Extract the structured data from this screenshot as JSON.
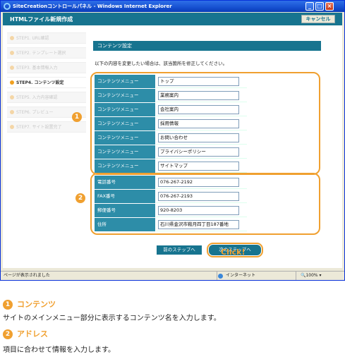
{
  "window": {
    "title": "SiteCreationコントロールパネル - Windows Internet Explorer",
    "minimize_glyph": "_",
    "maximize_glyph": "□",
    "close_glyph": "×"
  },
  "header": {
    "title": "HTMLファイル新規作成",
    "cancel_label": "キャンセル"
  },
  "sidebar": {
    "steps": [
      {
        "label": "STEP1. URL確認"
      },
      {
        "label": "STEP2. テンプレート選択"
      },
      {
        "label": "STEP3. 基本情報入力"
      },
      {
        "label": "STEP4. コンテンツ設定"
      },
      {
        "label": "STEP5. 入力内容確認"
      },
      {
        "label": "STEP6. プレビュー"
      },
      {
        "label": "STEP7. サイト設置完了"
      }
    ]
  },
  "main": {
    "section_title": "コンテンツ設定",
    "instructions": "以下の内容を変更したい場合は、該当箇所を修正してください。",
    "content_rows": [
      {
        "label": "コンテンツメニュー",
        "value": "トップ"
      },
      {
        "label": "コンテンツメニュー",
        "value": "業務案内"
      },
      {
        "label": "コンテンツメニュー",
        "value": "会社案内"
      },
      {
        "label": "コンテンツメニュー",
        "value": "採用情報"
      },
      {
        "label": "コンテンツメニュー",
        "value": "お問い合わせ"
      },
      {
        "label": "コンテンツメニュー",
        "value": "プライバシーポリシー"
      },
      {
        "label": "コンテンツメニュー",
        "value": "サイトマップ"
      }
    ],
    "address_rows": [
      {
        "label": "電話番号",
        "value": "076-267-2192"
      },
      {
        "label": "FAX番号",
        "value": "076-267-2193"
      },
      {
        "label": "郵便番号",
        "value": "920-8203"
      },
      {
        "label": "住所",
        "value": "石川県金沢市鞍月四丁目187番地"
      }
    ],
    "prev_button": "前のステップへ",
    "next_button": "次のステップへ",
    "click_label": "Click!",
    "badge1": "1",
    "badge2": "2"
  },
  "statusbar": {
    "left_text": "ページが表示されました",
    "zone": "インターネット",
    "zoom": "100%"
  },
  "explanations": [
    {
      "number": "1",
      "heading": "コンテンツ",
      "text": "サイトのメインメニュー部分に表示するコンテンツ名を入力します。"
    },
    {
      "number": "2",
      "heading": "アドレス",
      "text": "項目に合わせて情報を入力します。"
    }
  ],
  "colors": {
    "accent_orange": "#F0A030",
    "header_teal": "#17748F",
    "label_teal": "#2D8DA8"
  }
}
